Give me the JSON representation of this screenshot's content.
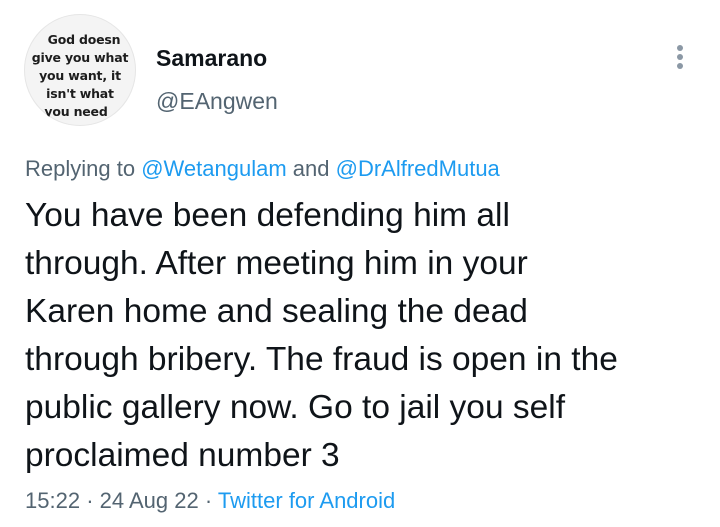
{
  "user": {
    "display_name": "Samarano",
    "handle": "@EAngwen",
    "avatar_text": [
      "God doesn",
      "give you what",
      "you want, it",
      "isn't what",
      "you need"
    ]
  },
  "reply": {
    "prefix": "Replying to",
    "mention1": "@Wetangulam",
    "conjunction": "and",
    "mention2": "@DrAlfredMutua"
  },
  "tweet": {
    "lines": [
      "You have been defending him all",
      "through. After meeting him in your",
      "Karen home and sealing the dead",
      "through bribery. The fraud is open in the",
      "public gallery now. Go to jail you self",
      "proclaimed number 3"
    ]
  },
  "meta": {
    "time": "15:22",
    "sep1": "·",
    "date": "24 Aug 22",
    "sep2": "·",
    "source": "Twitter for Android"
  },
  "icons": {
    "more": "more-options-icon"
  },
  "colors": {
    "link": "#1d9bf0",
    "secondary_text": "#536471",
    "primary_text": "#0f1419"
  }
}
